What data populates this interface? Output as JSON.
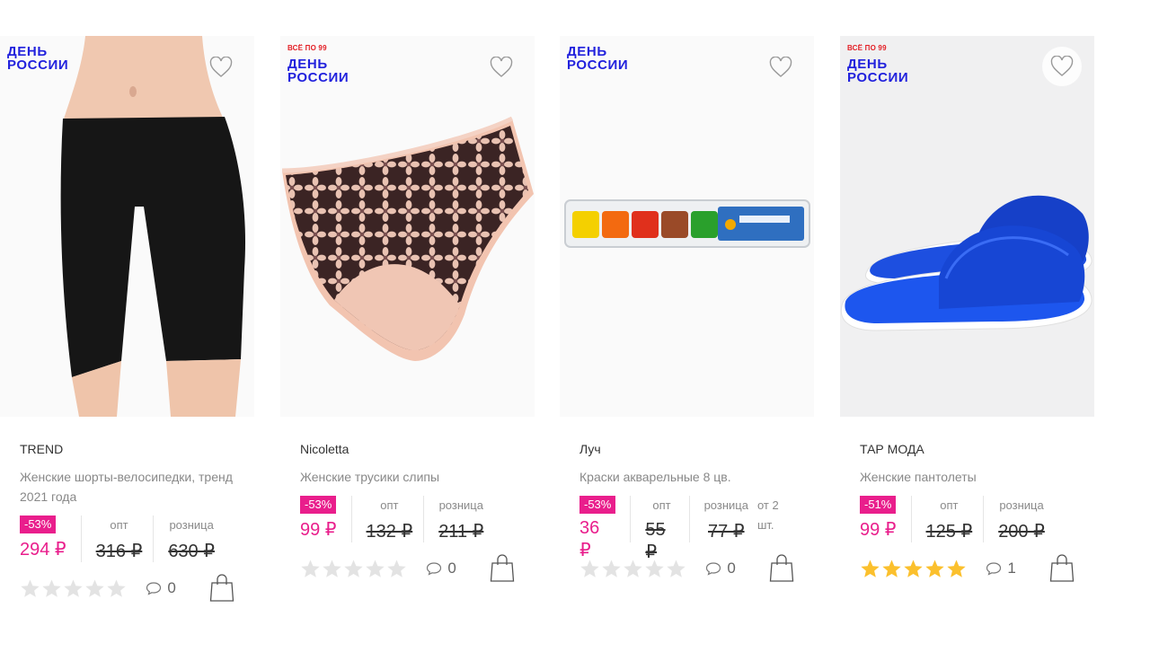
{
  "colors": {
    "promo_blue": "#2222dd",
    "promo_red": "#e31e24",
    "accent_pink": "#e91e8c",
    "star_gold": "#fbc02d",
    "star_empty": "#e3e3e3"
  },
  "products": [
    {
      "promo_sub": "",
      "promo_main": "ДЕНЬ\nРОССИИ",
      "brand": "TREND",
      "title": "Женские шорты-велосипедки, тренд 2021 года",
      "discount": "-53%",
      "price": "294 ₽",
      "opt_label": "опт",
      "opt_price": "316 ₽",
      "retail_label": "розница",
      "retail_price": "630 ₽",
      "extra": "",
      "rating": 0,
      "reviews": "0",
      "image": "black-bike-shorts"
    },
    {
      "promo_sub": "ВСЁ ПО 99",
      "promo_main": "ДЕНЬ\nРОССИИ",
      "brand": "Nicoletta",
      "title": "Женские трусики слипы",
      "discount": "-53%",
      "price": "99 ₽",
      "opt_label": "опт",
      "opt_price": "132 ₽",
      "retail_label": "розница",
      "retail_price": "211 ₽",
      "extra": "",
      "rating": 0,
      "reviews": "0",
      "image": "floral-briefs"
    },
    {
      "promo_sub": "",
      "promo_main": "ДЕНЬ\nРОССИИ",
      "brand": "Луч",
      "title": "Краски акварельные 8 цв.",
      "discount": "-53%",
      "price": "36 ₽",
      "opt_label": "опт",
      "opt_price": "55 ₽",
      "retail_label": "розница",
      "retail_price": "77 ₽",
      "extra": "от 2 шт.",
      "rating": 0,
      "reviews": "0",
      "image": "watercolor-paint-set"
    },
    {
      "promo_sub": "ВСЁ ПО 99",
      "promo_main": "ДЕНЬ\nРОССИИ",
      "brand": "ТАР МОДА",
      "title": "Женские пантолеты",
      "discount": "-51%",
      "price": "99 ₽",
      "opt_label": "опт",
      "opt_price": "125 ₽",
      "retail_label": "розница",
      "retail_price": "200 ₽",
      "extra": "",
      "rating": 5,
      "reviews": "1",
      "image": "blue-slippers"
    }
  ]
}
